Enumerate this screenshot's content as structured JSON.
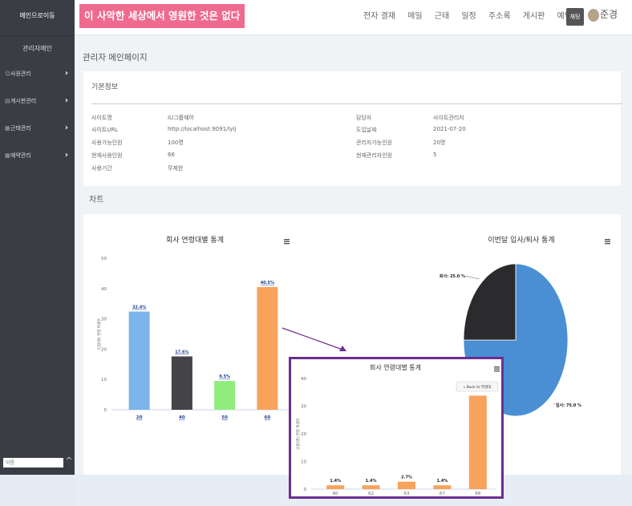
{
  "sidebar": {
    "home": "메인으로이동",
    "admin": "관리자메인",
    "items": [
      {
        "icon": "person-icon",
        "label": "사원관리"
      },
      {
        "icon": "board-icon",
        "label": "게시판관리"
      },
      {
        "icon": "calendar-icon",
        "label": "근태관리"
      },
      {
        "icon": "reserve-icon",
        "label": "예약관리"
      }
    ],
    "search_placeholder": "이름"
  },
  "topbar": {
    "slogan": "이 사악한 세상에서 영원한 것은 없다",
    "nav": [
      "전자 결재",
      "메일",
      "근태",
      "일정",
      "주소록",
      "게시판",
      "예약"
    ],
    "chat": "채팅",
    "user": "준경"
  },
  "main": {
    "page_title": "관리자 메인페이지",
    "basic_info": {
      "title": "기본정보",
      "left": [
        {
          "label": "사이트명",
          "value": "IU그룹웨어"
        },
        {
          "label": "사이트URL",
          "value": "http://localhost:9091/lylj"
        },
        {
          "label": "사용가능인원",
          "value": "100명"
        },
        {
          "label": "현재사용인원",
          "value": "66"
        },
        {
          "label": "사용기간",
          "value": "무제한"
        }
      ],
      "right": [
        {
          "label": "담당자",
          "value": "사이트관리자"
        },
        {
          "label": "도입날짜",
          "value": "2021-07-20"
        },
        {
          "label": "관리자가능인원",
          "value": "20명"
        },
        {
          "label": "현재관리자인원",
          "value": "5"
        }
      ]
    },
    "chart_section_title": "차트"
  },
  "colors": {
    "sidebar": "#3a3d43",
    "slogan_bg": "#f06a8e",
    "popup_border": "#6b2f8f"
  },
  "chart_data": [
    {
      "type": "bar",
      "title": "회사 연령대별 통계",
      "ylabel": "인원(명) 연령 퍼센트",
      "categories": [
        "20",
        "40",
        "50",
        "60"
      ],
      "values": [
        32.4,
        17.6,
        9.5,
        40.5
      ],
      "data_labels": [
        "32.4%",
        "17.6%",
        "9.5%",
        "40.5%"
      ],
      "colors": [
        "#7cb5ec",
        "#434348",
        "#90ed7d",
        "#f7a35c"
      ],
      "ylim": [
        0,
        50
      ],
      "yticks": [
        0,
        10,
        20,
        30,
        40,
        50
      ]
    },
    {
      "type": "pie",
      "title": "이번달 입사/퇴사 통계",
      "slices": [
        {
          "label": "입사: 75.0 %",
          "value": 75.0,
          "color": "#4a8fd3"
        },
        {
          "label": "퇴사: 25.0 %",
          "value": 25.0,
          "color": "#2b2b2e"
        }
      ]
    },
    {
      "type": "bar",
      "title": "회사 연령대별 통계",
      "ylabel": "인원(명) 연령 퍼센트",
      "back_button": "« Back to 연령대",
      "categories": [
        "60",
        "62",
        "63",
        "67",
        "68"
      ],
      "values": [
        1.4,
        1.4,
        2.7,
        1.4,
        33.8
      ],
      "data_labels": [
        "1.4%",
        "1.4%",
        "2.7%",
        "1.4%",
        ""
      ],
      "colors": [
        "#f7a35c",
        "#f7a35c",
        "#f7a35c",
        "#f7a35c",
        "#f7a35c"
      ],
      "ylim": [
        0,
        40
      ],
      "yticks": [
        0,
        10,
        20,
        30,
        40
      ]
    }
  ]
}
